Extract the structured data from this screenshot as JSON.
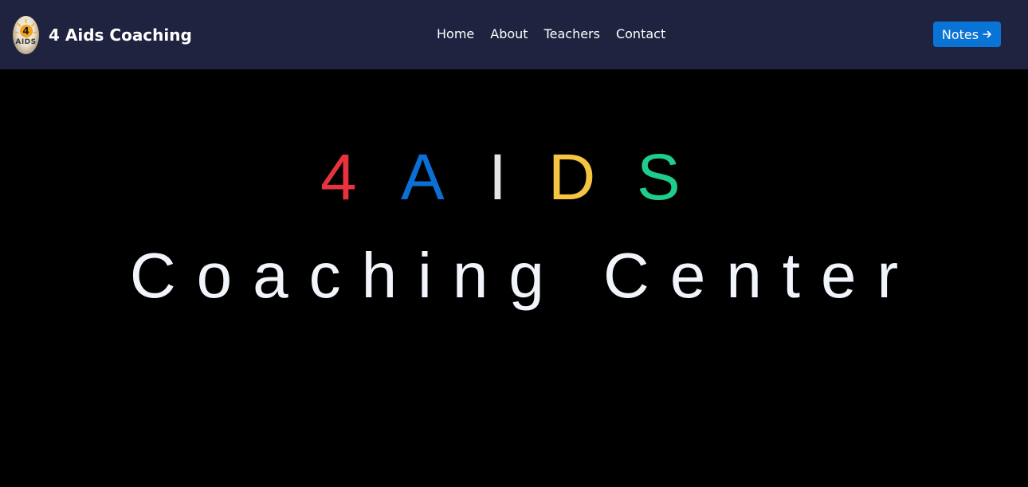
{
  "navbar": {
    "brand_name": "4 Aids Coaching",
    "logo": {
      "icon": "4-aids-logo-icon",
      "number": "4",
      "word": "AIDS"
    },
    "links": [
      {
        "label": "Home"
      },
      {
        "label": "About"
      },
      {
        "label": "Teachers"
      },
      {
        "label": "Contact"
      }
    ],
    "notes_button": {
      "label": "Notes",
      "icon": "arrow-right-icon"
    },
    "background": "#1f2340"
  },
  "hero": {
    "letters": [
      {
        "char": "4",
        "color": "#e8333c"
      },
      {
        "char": "A",
        "color": "#0b6fd6"
      },
      {
        "char": "I",
        "color": "#e6e6e6"
      },
      {
        "char": "D",
        "color": "#f5c542"
      },
      {
        "char": "S",
        "color": "#1fcc8b"
      }
    ],
    "subtitle": "Coaching Center",
    "background": "#000000"
  },
  "colors": {
    "accent": "#0a73d6",
    "text": "#ffffff"
  }
}
